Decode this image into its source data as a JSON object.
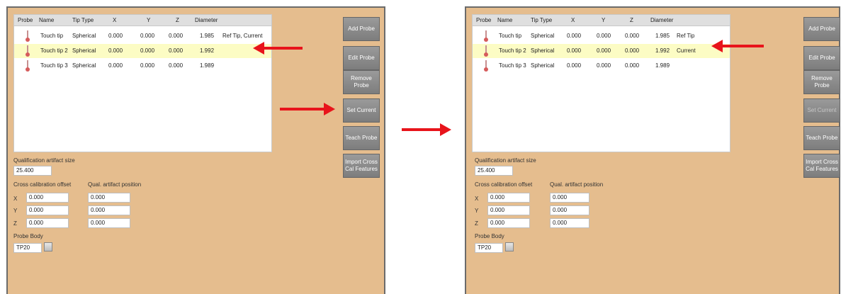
{
  "before": {
    "columns": [
      "Probe",
      "Name",
      "Tip Type",
      "X",
      "Y",
      "Z",
      "Diameter"
    ],
    "rows": [
      {
        "name": "Touch tip",
        "tip_type": "Spherical",
        "x": "0.000",
        "y": "0.000",
        "z": "0.000",
        "diameter": "1.985",
        "status": "Ref Tip, Current"
      },
      {
        "name": "Touch tip 2",
        "tip_type": "Spherical",
        "x": "0.000",
        "y": "0.000",
        "z": "0.000",
        "diameter": "1.992",
        "status": ""
      },
      {
        "name": "Touch tip 3",
        "tip_type": "Spherical",
        "x": "0.000",
        "y": "0.000",
        "z": "0.000",
        "diameter": "1.989",
        "status": ""
      }
    ],
    "buttons": {
      "add": "Add Probe",
      "edit": "Edit Probe",
      "remove": "Remove Probe",
      "set_current": "Set Current",
      "teach": "Teach Probe",
      "import": "Import Cross Cal Features"
    }
  },
  "after": {
    "columns": [
      "Probe",
      "Name",
      "Tip Type",
      "X",
      "Y",
      "Z",
      "Diameter"
    ],
    "rows": [
      {
        "name": "Touch tip",
        "tip_type": "Spherical",
        "x": "0.000",
        "y": "0.000",
        "z": "0.000",
        "diameter": "1.985",
        "status": "Ref Tip"
      },
      {
        "name": "Touch tip 2",
        "tip_type": "Spherical",
        "x": "0.000",
        "y": "0.000",
        "z": "0.000",
        "diameter": "1.992",
        "status": "Current"
      },
      {
        "name": "Touch tip 3",
        "tip_type": "Spherical",
        "x": "0.000",
        "y": "0.000",
        "z": "0.000",
        "diameter": "1.989",
        "status": ""
      }
    ],
    "buttons": {
      "add": "Add Probe",
      "edit": "Edit Probe",
      "remove": "Remove Probe",
      "set_current": "Set Current",
      "teach": "Teach Probe",
      "import": "Import Cross Cal Features"
    }
  },
  "form": {
    "qual_size_label": "Qualification artifact size",
    "qual_size_value": "25.400",
    "cross_cal_label": "Cross calibration offset",
    "qual_pos_label": "Qual. artifact position",
    "axis_x": "X",
    "axis_y": "Y",
    "axis_z": "Z",
    "cross_x": "0.000",
    "cross_y": "0.000",
    "cross_z": "0.000",
    "pos_x": "0.000",
    "pos_y": "0.000",
    "pos_z": "0.000",
    "probe_body_label": "Probe Body",
    "probe_body_value": "TP20"
  },
  "colors": {
    "arrow": "#e8141b",
    "selected_row": "#fcfcc4",
    "panel_bg": "#e5bd8e"
  }
}
